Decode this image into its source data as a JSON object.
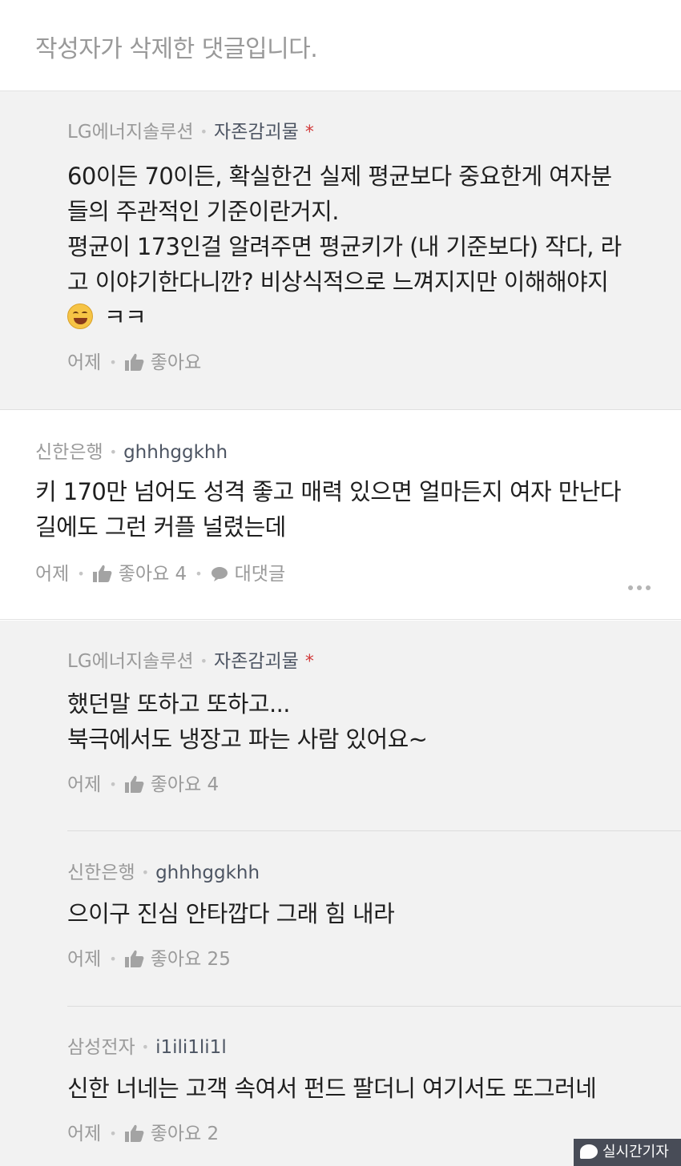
{
  "deleted_notice": "작성자가 삭제한 댓글입니다.",
  "comments": [
    {
      "org": "LG에너지솔루션",
      "nick": "자존감괴물",
      "star": "*",
      "lines": [
        "60이든 70이든, 확실한건 실제 평균보다 중요한게 여자분",
        "들의 주관적인 기준이란거지.",
        "평균이 173인걸 알려주면 평균키가 (내 기준보다) 작다, 라",
        "고 이야기한다니깐? 비상식적으로 느껴지지만 이해해야지"
      ],
      "last_line": "ㅋㅋ",
      "emoji": "grinning-sweat-emoji",
      "time": "어제",
      "like": "좋아요"
    },
    {
      "org": "신한은행",
      "nick": "ghhhggkhh",
      "lines": [
        "키 170만 넘어도 성격 좋고 매력 있으면 얼마든지 여자 만난다",
        "길에도 그런 커플 널렸는데"
      ],
      "time": "어제",
      "like": "좋아요 4",
      "reply": "대댓글"
    },
    {
      "org": "LG에너지솔루션",
      "nick": "자존감괴물",
      "star": "*",
      "lines": [
        "했던말 또하고 또하고...",
        "북극에서도 냉장고 파는 사람 있어요~"
      ],
      "time": "어제",
      "like": "좋아요 4"
    },
    {
      "org": "신한은행",
      "nick": "ghhhggkhh",
      "lines": [
        "으이구 진심 안타깝다 그래 힘 내라"
      ],
      "time": "어제",
      "like": "좋아요 25"
    },
    {
      "org": "삼성전자",
      "nick": "i1ili1li1l",
      "lines": [
        "신한 너네는 고객 속여서 펀드 팔더니 여기서도 또그러네"
      ],
      "time": "어제",
      "like": "좋아요 2"
    }
  ],
  "watermark": "실시간기자",
  "colors": {
    "reply_bg": "#f2f2f2",
    "star": "#d23a3a",
    "nick": "#4d5563",
    "meta": "#9a9a9a"
  }
}
